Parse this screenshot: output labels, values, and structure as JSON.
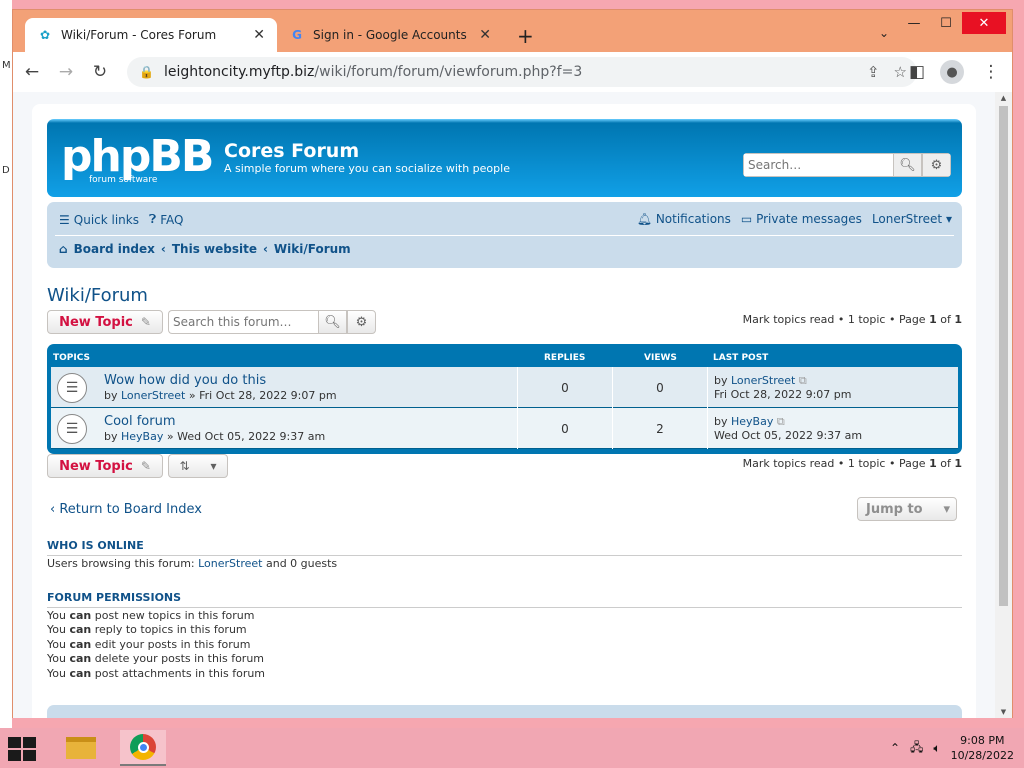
{
  "browser": {
    "tabs": [
      {
        "label": "Wiki/Forum - Cores Forum",
        "icon": "phpbb-favicon"
      },
      {
        "label": "Sign in - Google Accounts",
        "icon": "google-favicon"
      }
    ],
    "url_host": "leightoncity.myftp.biz",
    "url_path": "/wiki/forum/forum/viewforum.php?f=3"
  },
  "header": {
    "logo_text": "phpBB",
    "logo_sub": "forum software",
    "site_title": "Cores Forum",
    "site_desc": "A simple forum where you can socialize with people",
    "search_placeholder": "Search…"
  },
  "navbar": {
    "quick_links": "Quick links",
    "faq": "FAQ",
    "notifications": "Notifications",
    "private_messages": "Private messages",
    "username": "LonerStreet",
    "crumbs": [
      "Board index",
      "This website",
      "Wiki/Forum"
    ]
  },
  "forum": {
    "title": "Wiki/Forum",
    "new_topic": "New Topic",
    "search_placeholder": "Search this forum…",
    "pagination": {
      "mark_read": "Mark topics read",
      "topic_count": "1 topic",
      "page_label": "Page",
      "page": "1",
      "of": "of",
      "total": "1"
    },
    "columns": {
      "topics": "Topics",
      "replies": "Replies",
      "views": "Views",
      "last_post": "Last post"
    },
    "topics": [
      {
        "title": "Wow how did you do this",
        "by": "by",
        "author": "LonerStreet",
        "date": "» Fri Oct 28, 2022 9:07 pm",
        "replies": "0",
        "views": "0",
        "last_by": "LonerStreet",
        "last_date": "Fri Oct 28, 2022 9:07 pm"
      },
      {
        "title": "Cool forum",
        "by": "by",
        "author": "HeyBay",
        "date": "» Wed Oct 05, 2022 9:37 am",
        "replies": "0",
        "views": "2",
        "last_by": "HeyBay",
        "last_date": "Wed Oct 05, 2022 9:37 am"
      }
    ],
    "return_link": "Return to Board Index",
    "jump_to": "Jump to"
  },
  "who_online": {
    "heading": "WHO IS ONLINE",
    "text_prefix": "Users browsing this forum: ",
    "user": "LonerStreet",
    "text_suffix": " and 0 guests"
  },
  "permissions": {
    "heading": "FORUM PERMISSIONS",
    "lines": [
      {
        "pre": "You ",
        "can": "can",
        "post": " post new topics in this forum"
      },
      {
        "pre": "You ",
        "can": "can",
        "post": " reply to topics in this forum"
      },
      {
        "pre": "You ",
        "can": "can",
        "post": " edit your posts in this forum"
      },
      {
        "pre": "You ",
        "can": "can",
        "post": " delete your posts in this forum"
      },
      {
        "pre": "You ",
        "can": "can",
        "post": " post attachments in this forum"
      }
    ]
  },
  "taskbar": {
    "time": "9:08 PM",
    "date": "10/28/2022"
  },
  "colors": {
    "phpbb_blue": "#0076b1",
    "link": "#105289",
    "new_topic_red": "#d31141"
  }
}
